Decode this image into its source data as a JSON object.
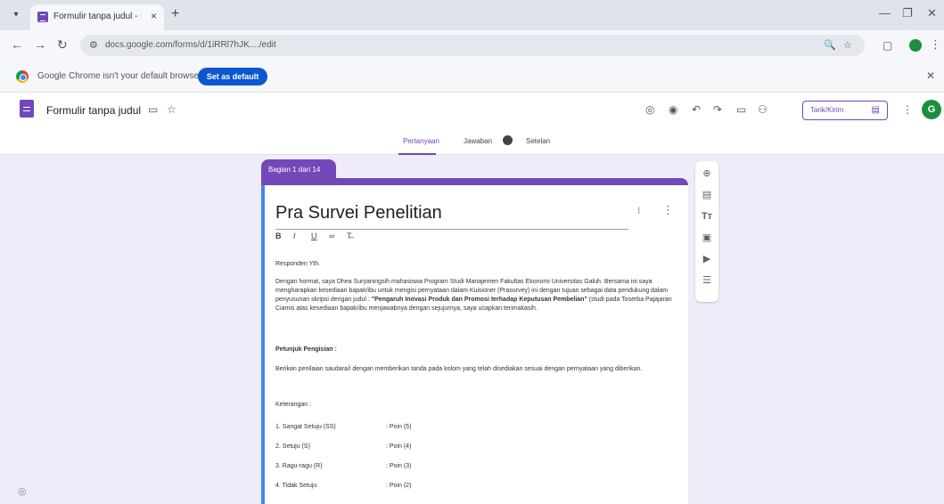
{
  "browser": {
    "tab_title": "Formulir tanpa judul - Google",
    "url": "docs.google.com/forms/d/1iRRl7hJK..../edit",
    "infobar_text": "Google Chrome isn't your default browser",
    "set_default_label": "Set as default"
  },
  "forms": {
    "title": "Formulir tanpa judul",
    "send_label": "Tarik/Kirim",
    "avatar_letter": "G",
    "tabs": [
      "Pertanyaan",
      "Jawaban",
      "Setelan"
    ]
  },
  "section": {
    "label": "Bagian 1 dari 14",
    "title": "Pra Survei Penelitian",
    "greeting": "Responden Yth.",
    "paragraph_1": "Dengan hormat, saya Dhea Suryaningsih mahasiswa Program Studi Manajemen Fakultas Ekonomi Universitas Galuh. Bersama ini saya mengharapkan kesediaan bapak/ibu untuk mengisi pernyataan dalam Kuisioner (Prasurvey) ini dengan tujuan sebagai data pendukung dalam penyusunan skripsi dengan judul :",
    "paragraph_1_bold": "\"Pengaruh Inovasi Produk dan Promosi terhadap Keputusan Pembelian\"",
    "paragraph_1_end": "(studi pada Toserba Pajajaran Ciamis atas kesediaan bapak/ibu menjawabnya dengan sejujurnya, saya ucapkan terimakasih.",
    "instructions_heading": "Petunjuk Pengisian :",
    "instructions_text": "Berikan penilaian saudara/i dengan memberikan tanda pada kolom yang telah disediakan sesuai dengan pernyataan yang diberikan.",
    "legend_heading": "Keterangan :",
    "legend": [
      {
        "label": "1. Sangat Setuju (SS)",
        "value": ": Poin (5)"
      },
      {
        "label": "2. Setuju (S)",
        "value": ": Poin (4)"
      },
      {
        "label": "3. Ragu-ragu (R)",
        "value": ": Poin (3)"
      },
      {
        "label": "4. Tidak Setuju",
        "value": ": Poin (2)"
      }
    ]
  }
}
